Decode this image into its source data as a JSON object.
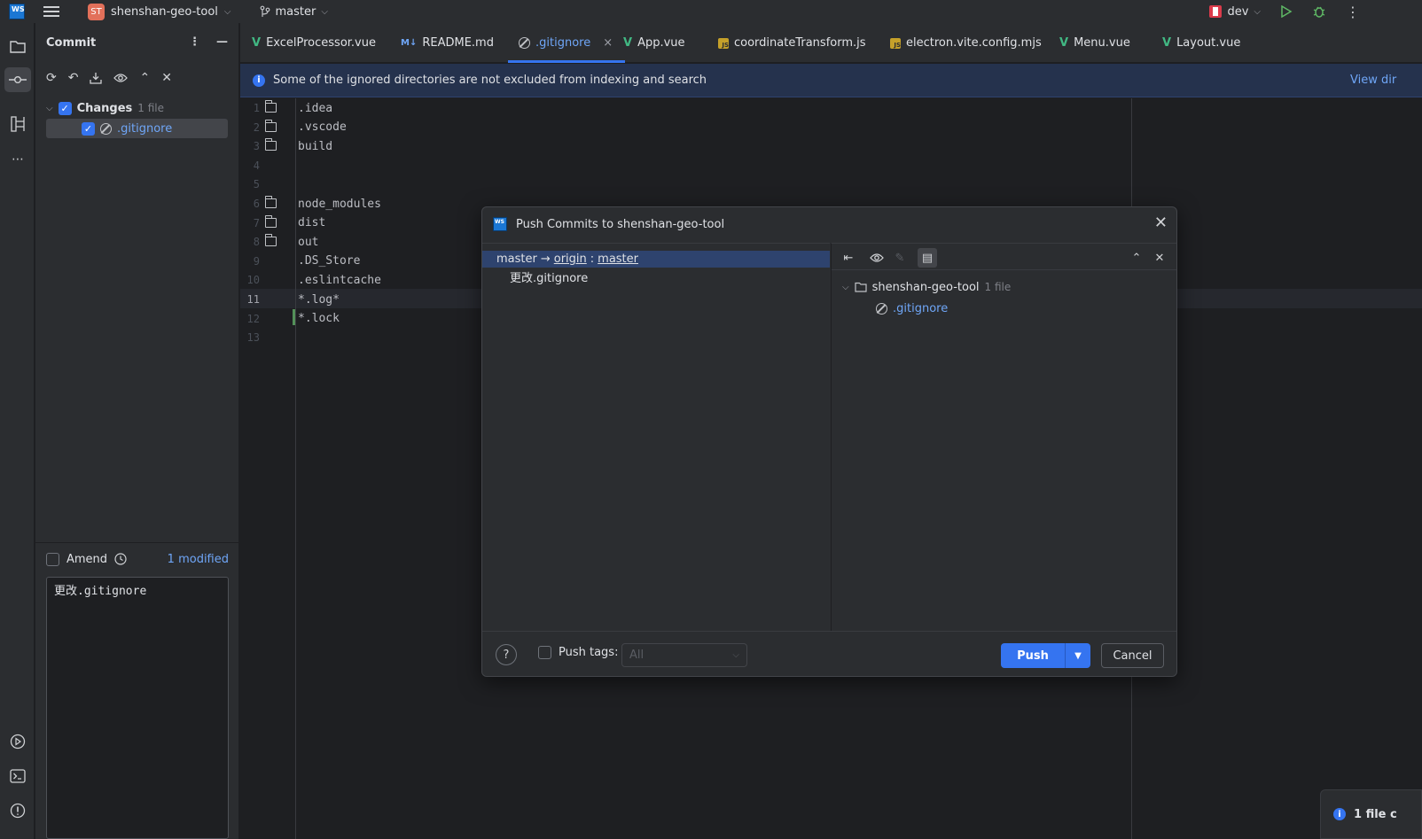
{
  "titlebar": {
    "logo_text": "WS",
    "project_badge": "ST",
    "project_name": "shenshan-geo-tool",
    "branch": "master",
    "run_config": "dev"
  },
  "commit_panel": {
    "title": "Commit",
    "changes_label": "Changes",
    "changes_count": "1 file",
    "files": [
      ".gitignore"
    ],
    "amend_label": "Amend",
    "modified_count": "1 modified",
    "message": "更改.gitignore"
  },
  "tabs": [
    {
      "label": "ExcelProcessor.vue",
      "icon": "vue-icon"
    },
    {
      "label": "README.md",
      "icon": "markdown-icon"
    },
    {
      "label": ".gitignore",
      "icon": "ignore-file-icon",
      "active": true
    },
    {
      "label": "App.vue",
      "icon": "vue-icon"
    },
    {
      "label": "coordinateTransform.js",
      "icon": "js-icon"
    },
    {
      "label": "electron.vite.config.mjs",
      "icon": "js-icon"
    },
    {
      "label": "Menu.vue",
      "icon": "vue-icon"
    },
    {
      "label": "Layout.vue",
      "icon": "vue-icon"
    }
  ],
  "banner": {
    "message": "Some of the ignored directories are not excluded from indexing and search",
    "link": "View dir"
  },
  "editor": {
    "lines": [
      {
        "n": "1",
        "text": ".idea",
        "folder": true
      },
      {
        "n": "2",
        "text": ".vscode",
        "folder": true
      },
      {
        "n": "3",
        "text": "build",
        "folder": true
      },
      {
        "n": "4",
        "text": "",
        "folder": false
      },
      {
        "n": "5",
        "text": "",
        "folder": false
      },
      {
        "n": "6",
        "text": "node_modules",
        "folder": true
      },
      {
        "n": "7",
        "text": "dist",
        "folder": true
      },
      {
        "n": "8",
        "text": "out",
        "folder": true
      },
      {
        "n": "9",
        "text": ".DS_Store",
        "folder": false
      },
      {
        "n": "10",
        "text": ".eslintcache",
        "folder": false
      },
      {
        "n": "11",
        "text": "*.log*",
        "folder": false
      },
      {
        "n": "12",
        "text": "*.lock",
        "folder": false
      },
      {
        "n": "13",
        "text": "",
        "folder": false
      }
    ]
  },
  "dialog": {
    "title": "Push Commits to shenshan-geo-tool",
    "branch_from": "master",
    "arrow": "→",
    "remote": "origin",
    "separator": ":",
    "branch_to": "master",
    "commit_message": "更改.gitignore",
    "repo_name": "shenshan-geo-tool",
    "repo_count": "1 file",
    "file": ".gitignore",
    "help": "?",
    "push_tags_label": "Push tags:",
    "tags_select_value": "All",
    "push_label": "Push",
    "cancel_label": "Cancel"
  },
  "notification": {
    "text": "1 file c"
  }
}
